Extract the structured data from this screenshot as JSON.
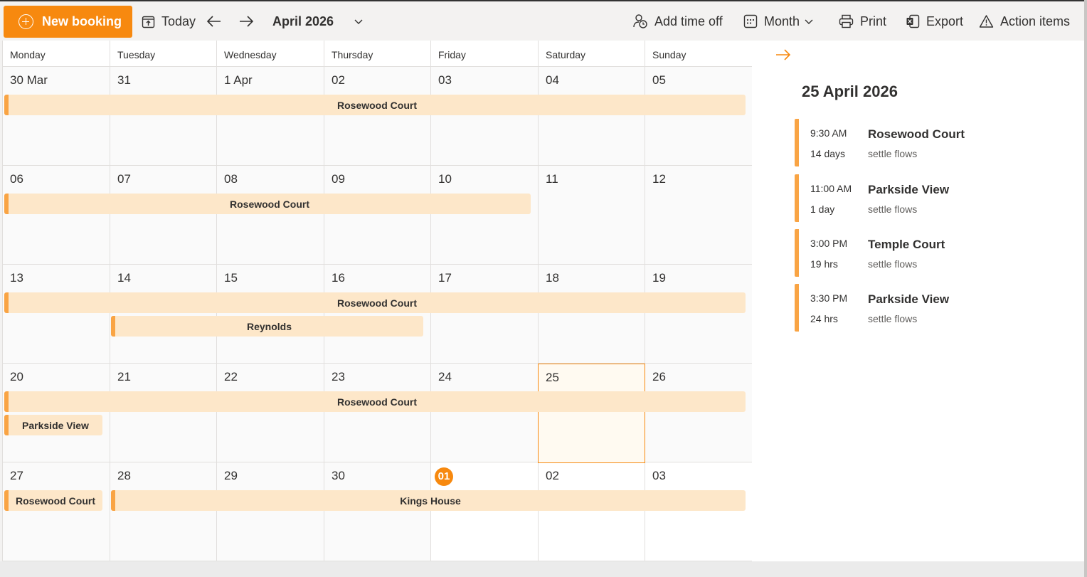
{
  "toolbar": {
    "new_booking": "New booking",
    "today": "Today",
    "month_label": "April 2026",
    "add_time_off": "Add time off",
    "view": "Month",
    "print": "Print",
    "export": "Export",
    "action_items": "Action items"
  },
  "colors": {
    "accent": "#f7890f",
    "event_fill": "#fde7c9",
    "event_bar": "#f9a444"
  },
  "weekdays": [
    "Monday",
    "Tuesday",
    "Wednesday",
    "Thursday",
    "Friday",
    "Saturday",
    "Sunday"
  ],
  "weeks": [
    [
      "30 Mar",
      "31",
      "1 Apr",
      "02",
      "03",
      "04",
      "05"
    ],
    [
      "06",
      "07",
      "08",
      "09",
      "10",
      "11",
      "12"
    ],
    [
      "13",
      "14",
      "15",
      "16",
      "17",
      "18",
      "19"
    ],
    [
      "20",
      "21",
      "22",
      "23",
      "24",
      "25",
      "26"
    ],
    [
      "27",
      "28",
      "29",
      "30",
      "01",
      "02",
      "03"
    ]
  ],
  "current_month_flags": [
    [
      false,
      false,
      true,
      true,
      true,
      true,
      true
    ],
    [
      true,
      true,
      true,
      true,
      true,
      true,
      true
    ],
    [
      true,
      true,
      true,
      true,
      true,
      true,
      true
    ],
    [
      true,
      true,
      true,
      true,
      true,
      true,
      true
    ],
    [
      true,
      true,
      true,
      true,
      false,
      false,
      false
    ]
  ],
  "today_cell": {
    "week": 4,
    "day": 4
  },
  "selected_cell": {
    "week": 3,
    "day": 5
  },
  "events": [
    {
      "title": "Rosewood Court",
      "week": 0,
      "start_day": 0,
      "span_days": 7,
      "lane": 0
    },
    {
      "title": "Rosewood Court",
      "week": 1,
      "start_day": 0,
      "span_days": 5,
      "lane": 0
    },
    {
      "title": "Rosewood Court",
      "week": 2,
      "start_day": 0,
      "span_days": 7,
      "lane": 0
    },
    {
      "title": "Reynolds",
      "week": 2,
      "start_day": 1,
      "span_days": 3,
      "lane": 1
    },
    {
      "title": "Rosewood Court",
      "week": 3,
      "start_day": 0,
      "span_days": 7,
      "lane": 0
    },
    {
      "title": "Parkside View",
      "week": 3,
      "start_day": 0,
      "span_days": 1,
      "lane": 1
    },
    {
      "title": "Rosewood Court",
      "week": 4,
      "start_day": 0,
      "span_days": 1,
      "lane": 0
    },
    {
      "title": "Kings House",
      "week": 4,
      "start_day": 1,
      "span_days": 6,
      "lane": 0
    }
  ],
  "panel": {
    "date_heading": "25 April 2026",
    "agenda": [
      {
        "time": "9:30 AM",
        "duration": "14 days",
        "title": "Rosewood Court",
        "subtitle": "settle flows"
      },
      {
        "time": "11:00 AM",
        "duration": "1 day",
        "title": "Parkside View",
        "subtitle": "settle flows"
      },
      {
        "time": "3:00 PM",
        "duration": "19 hrs",
        "title": "Temple Court",
        "subtitle": "settle flows"
      },
      {
        "time": "3:30 PM",
        "duration": "24 hrs",
        "title": "Parkside View",
        "subtitle": "settle flows"
      }
    ]
  }
}
